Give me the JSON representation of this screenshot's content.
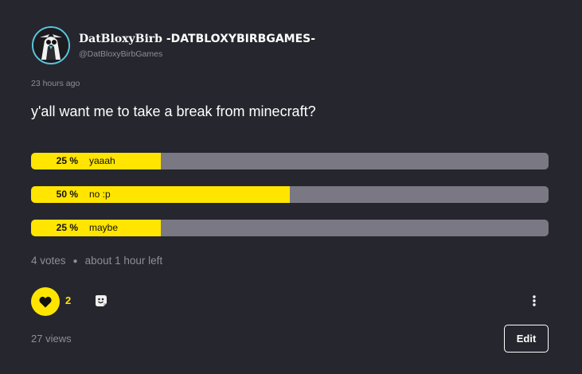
{
  "post": {
    "author": {
      "display_name_first": "DatBloxyBirb",
      "display_name_rest": " -DATBLOXYBIRBGAMES-",
      "handle": "@DatBloxyBirbGames",
      "avatar_icon": "penguin-avatar"
    },
    "timestamp": "23 hours ago",
    "question": "y'all want me to take a break from minecraft?"
  },
  "poll": {
    "options": [
      {
        "percent_label": "25 %",
        "label": "yaaah",
        "fraction": 0.25
      },
      {
        "percent_label": "50 %",
        "label": "no :p",
        "fraction": 0.5
      },
      {
        "percent_label": "25 %",
        "label": "maybe",
        "fraction": 0.25
      }
    ],
    "votes": "4 votes",
    "time_left": "about 1 hour left"
  },
  "actions": {
    "like_count": "2",
    "like_icon": "heart-icon",
    "emoji_icon": "emoji-reaction-icon",
    "more_icon": "more-vertical-icon",
    "edit_label": "Edit"
  },
  "stats": {
    "views": "27 views"
  },
  "colors": {
    "background": "#26262e",
    "accent": "#ffe500",
    "track": "#7a7882",
    "muted_text": "#8e8e99",
    "avatar_ring": "#5bc4dc"
  }
}
